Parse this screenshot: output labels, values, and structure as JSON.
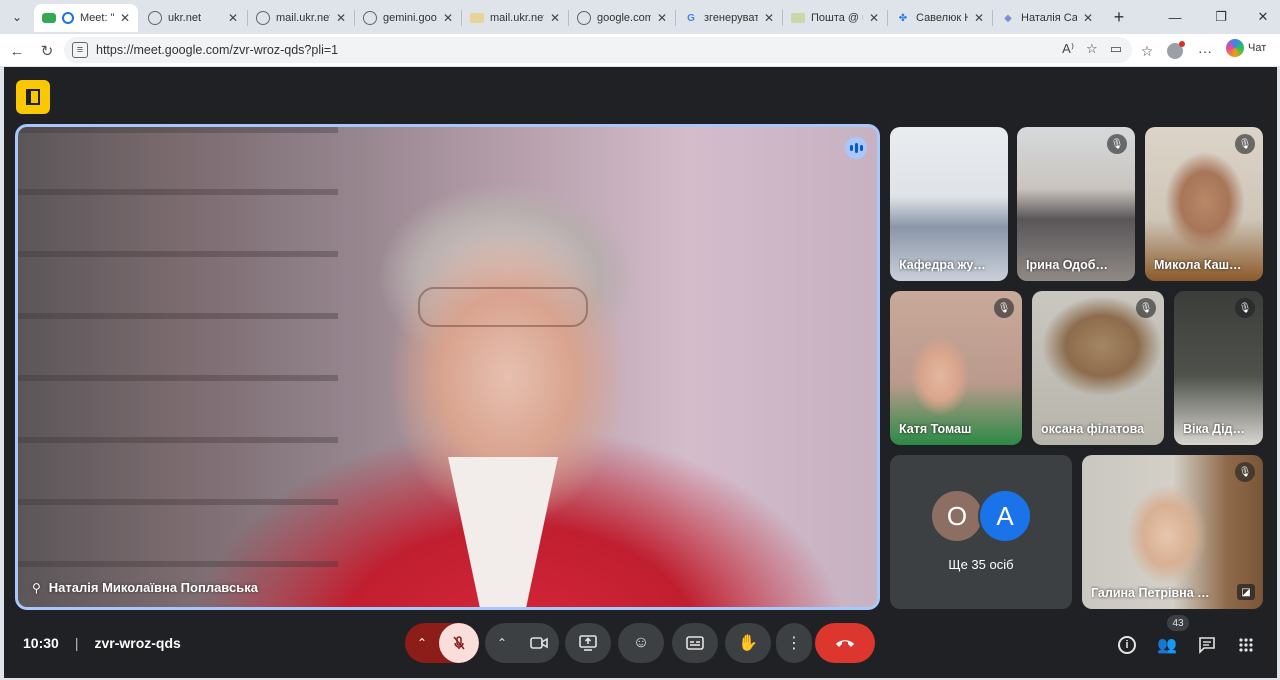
{
  "browser": {
    "tabs": [
      {
        "label": "Meet: \"zv",
        "active": true,
        "icon": "meet-icon"
      },
      {
        "label": "ukr.net",
        "active": false,
        "icon": "globe-icon"
      },
      {
        "label": "mail.ukr.net/c",
        "active": false,
        "icon": "globe-icon"
      },
      {
        "label": "gemini.googl",
        "active": false,
        "icon": "globe-icon"
      },
      {
        "label": "mail.ukr.net/c",
        "active": false,
        "icon": "mail-icon"
      },
      {
        "label": "google.com/",
        "active": false,
        "icon": "globe-icon"
      },
      {
        "label": "згенеруват",
        "active": false,
        "icon": "google-icon"
      },
      {
        "label": "Пошта @ uk",
        "active": false,
        "icon": "mail-icon"
      },
      {
        "label": "Савелюк Н.М",
        "active": false,
        "icon": "puzzle-icon"
      },
      {
        "label": "Наталія Саве",
        "active": false,
        "icon": "copilot-icon"
      }
    ],
    "url": "https://meet.google.com/zvr-wroz-qds?pli=1",
    "copilot_label": "Чат"
  },
  "meet": {
    "main_speaker": {
      "name": "Наталія Миколаївна Поплавська"
    },
    "tiles": [
      {
        "name": "Кафедра жу…",
        "muted": false
      },
      {
        "name": "Ірина Одоб…",
        "muted": true
      },
      {
        "name": "Микола Каш…",
        "muted": true
      },
      {
        "name": "Катя Томаш",
        "muted": true
      },
      {
        "name": "оксана філатова",
        "muted": true
      },
      {
        "name": "Віка Дід…",
        "muted": true
      },
      {
        "name": "Галина Петрівна …",
        "muted": true
      }
    ],
    "others": {
      "avatars": [
        "О",
        "А"
      ],
      "label": "Ще 35 осіб"
    },
    "bottom": {
      "time": "10:30",
      "meeting_code": "zvr-wroz-qds",
      "participants_count": "43"
    },
    "colors": {
      "background": "#202124",
      "end_call": "#dc362e",
      "mic_off": "#8c1d18",
      "active_border": "#a8c7fa",
      "sidepanel": "#f9c802"
    }
  }
}
